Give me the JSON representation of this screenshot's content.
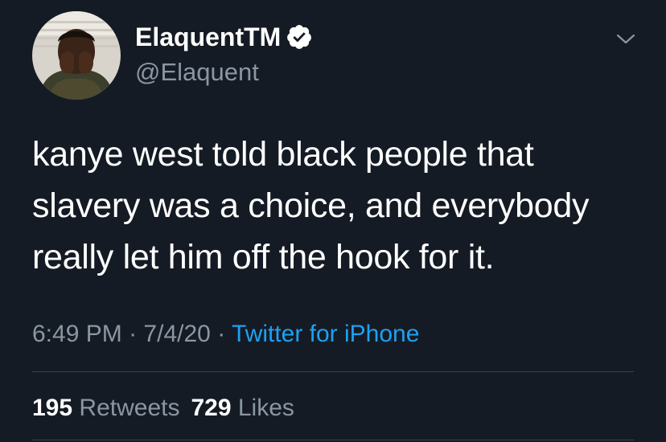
{
  "author": {
    "display_name": "ElaquentTM",
    "handle": "@Elaquent",
    "verified_icon": "verified-badge-icon",
    "avatar": "profile-photo"
  },
  "tweet": {
    "text": "kanye west told black people that slavery was a choice, and everybody really let him off the hook for it.",
    "time": "6:49 PM",
    "separator": "·",
    "date": "7/4/20",
    "source": "Twitter for iPhone"
  },
  "stats": {
    "retweets_count": "195",
    "retweets_label": "Retweets",
    "likes_count": "729",
    "likes_label": "Likes"
  },
  "menu_icon": "chevron-down-icon",
  "colors": {
    "background": "#151b24",
    "text": "#ffffff",
    "secondary_text": "#8a96a3",
    "link": "#1da1f2",
    "divider": "#38444d"
  }
}
